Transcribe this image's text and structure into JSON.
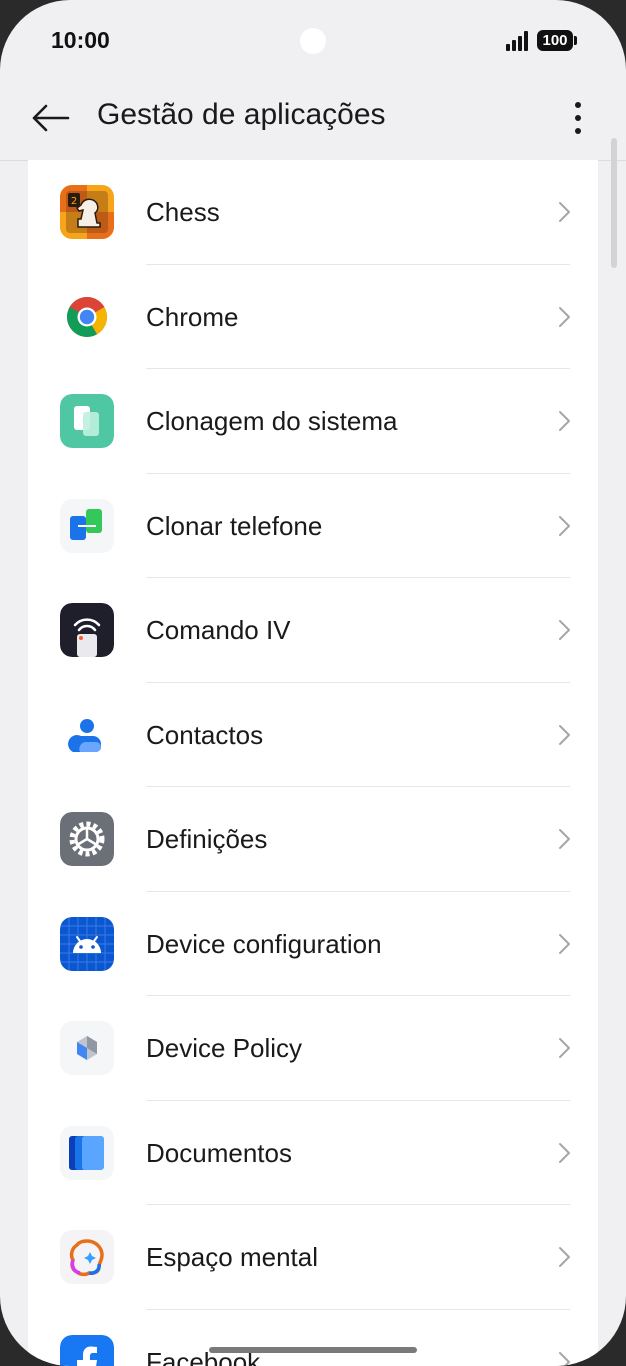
{
  "status_bar": {
    "time": "10:00",
    "battery": "100"
  },
  "app_bar": {
    "title": "Gestão de aplicações"
  },
  "apps": [
    {
      "label": "Chess",
      "icon": "chess-app-icon"
    },
    {
      "label": "Chrome",
      "icon": "chrome-app-icon"
    },
    {
      "label": "Clonagem do sistema",
      "icon": "system-clone-app-icon"
    },
    {
      "label": "Clonar telefone",
      "icon": "clone-phone-app-icon"
    },
    {
      "label": "Comando IV",
      "icon": "ir-remote-app-icon"
    },
    {
      "label": "Contactos",
      "icon": "contacts-app-icon"
    },
    {
      "label": "Definições",
      "icon": "settings-app-icon"
    },
    {
      "label": "Device configuration",
      "icon": "android-app-icon"
    },
    {
      "label": "Device Policy",
      "icon": "device-policy-app-icon"
    },
    {
      "label": "Documentos",
      "icon": "documents-app-icon"
    },
    {
      "label": "Espaço mental",
      "icon": "mental-space-app-icon"
    },
    {
      "label": "Facebook",
      "icon": "facebook-app-icon"
    }
  ]
}
